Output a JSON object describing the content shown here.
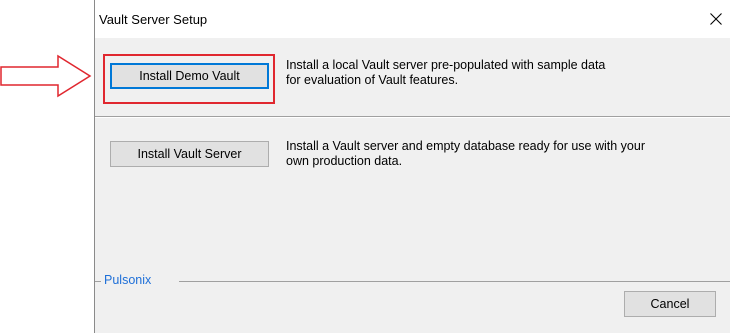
{
  "window": {
    "title": "Vault Server Setup",
    "close_symbol": "✕"
  },
  "options": [
    {
      "button_label": "Install Demo Vault",
      "description_line1": "Install a local Vault server pre-populated with sample data",
      "description_line2": "for evaluation of Vault features."
    },
    {
      "button_label": "Install Vault Server",
      "description_line1": "Install a Vault server and empty database ready for use with your",
      "description_line2": "own production data."
    }
  ],
  "footer": {
    "brand": "Pulsonix",
    "cancel_label": "Cancel"
  },
  "annotation": {
    "arrow_icon": "right-arrow-icon",
    "color": "#e0272f"
  }
}
